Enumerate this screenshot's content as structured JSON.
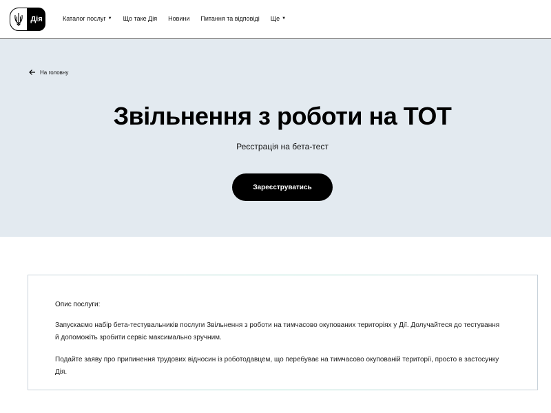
{
  "header": {
    "logo_text": "Дія",
    "nav": [
      {
        "label": "Каталог послуг",
        "has_caret": true
      },
      {
        "label": "Що таке Дія",
        "has_caret": false
      },
      {
        "label": "Новини",
        "has_caret": false
      },
      {
        "label": "Питання та відповіді",
        "has_caret": false
      },
      {
        "label": "Ще",
        "has_caret": true
      }
    ]
  },
  "hero": {
    "back_label": "На головну",
    "title": "Звільнення з роботи на ТОТ",
    "subtitle": "Реєстрація на бета-тест",
    "button_label": "Зареєструватись"
  },
  "description": {
    "heading": "Опис послуги:",
    "paragraph1": "Запускаємо набір бета-тестувальників послуги Звільнення з роботи на тимчасово окупованих територіях у Дії. Долучайтеся до тестування й допоможіть зробити сервіс максимально зручним.",
    "paragraph2": "Подайте заяву про припинення трудових відносин із роботодавцем, що перебуває на тимчасово окупованій території, просто в застосунку Дія."
  },
  "colors": {
    "hero_bg": "#e3eaf0",
    "button_bg": "#000000",
    "card_border_accent": "#a9e0d3"
  },
  "icons": {
    "logo": "trident-icon",
    "back": "arrow-left-icon",
    "dropdown": "chevron-down-icon"
  }
}
